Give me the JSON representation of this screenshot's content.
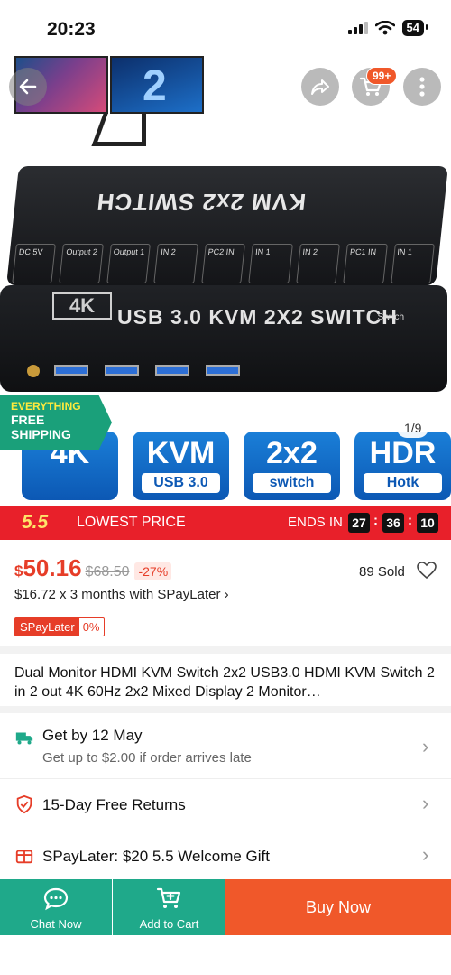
{
  "status": {
    "time": "20:23",
    "battery": "54"
  },
  "gallery": {
    "monitor_number": "2",
    "device_top_text": "KVM 2x2 SWITCH",
    "device_front_badge": "4K",
    "device_front_title": "USB 3.0  KVM 2X2 SWITCH",
    "device_switch_label": "Switch",
    "ports": [
      "DC 5V",
      "Output 2",
      "Output 1",
      "IN 2",
      "PC2 IN",
      "IN 1",
      "IN 2",
      "PC1 IN",
      "IN 1"
    ],
    "features": [
      {
        "big": "4K",
        "small": ""
      },
      {
        "big": "KVM",
        "small": "USB 3.0"
      },
      {
        "big": "2x2",
        "small": "switch"
      },
      {
        "big": "HDR",
        "small": "Hotk"
      }
    ],
    "counter": "1/9",
    "cart_count": "99+"
  },
  "free_shipping": {
    "line1": "EVERYTHING",
    "line2": "FREE",
    "line3": "SHIPPING"
  },
  "promo": {
    "badge": "5.5",
    "label": "LOWEST PRICE",
    "ends_label": "ENDS IN",
    "hours": "27",
    "minutes": "36",
    "seconds": "10"
  },
  "price": {
    "currency": "$",
    "current": "50.16",
    "original": "$68.50",
    "discount": "-27%",
    "sold": "89 Sold",
    "installment": "$16.72 x 3 months with SPayLater ›",
    "spay_tag": "SPayLater",
    "spay_rate": "0%"
  },
  "product_title": "Dual Monitor HDMI KVM Switch 2x2 USB3.0 HDMI KVM Switch 2 in 2 out 4K 60Hz 2x2 Mixed Display 2 Monitor…",
  "delivery": {
    "title": "Get by 12 May",
    "subtitle": "Get up to $2.00 if order arrives late"
  },
  "returns": {
    "title": "15-Day Free Returns"
  },
  "spaylater_gift": {
    "title": "SPayLater: $20 5.5 Welcome Gift"
  },
  "bottom": {
    "chat": "Chat Now",
    "add_to_cart": "Add to Cart",
    "buy_now": "Buy Now"
  },
  "colors": {
    "brand_orange": "#f0582a",
    "teal": "#1fa98a",
    "price_red": "#e63d28",
    "promo_red": "#e8202a"
  }
}
